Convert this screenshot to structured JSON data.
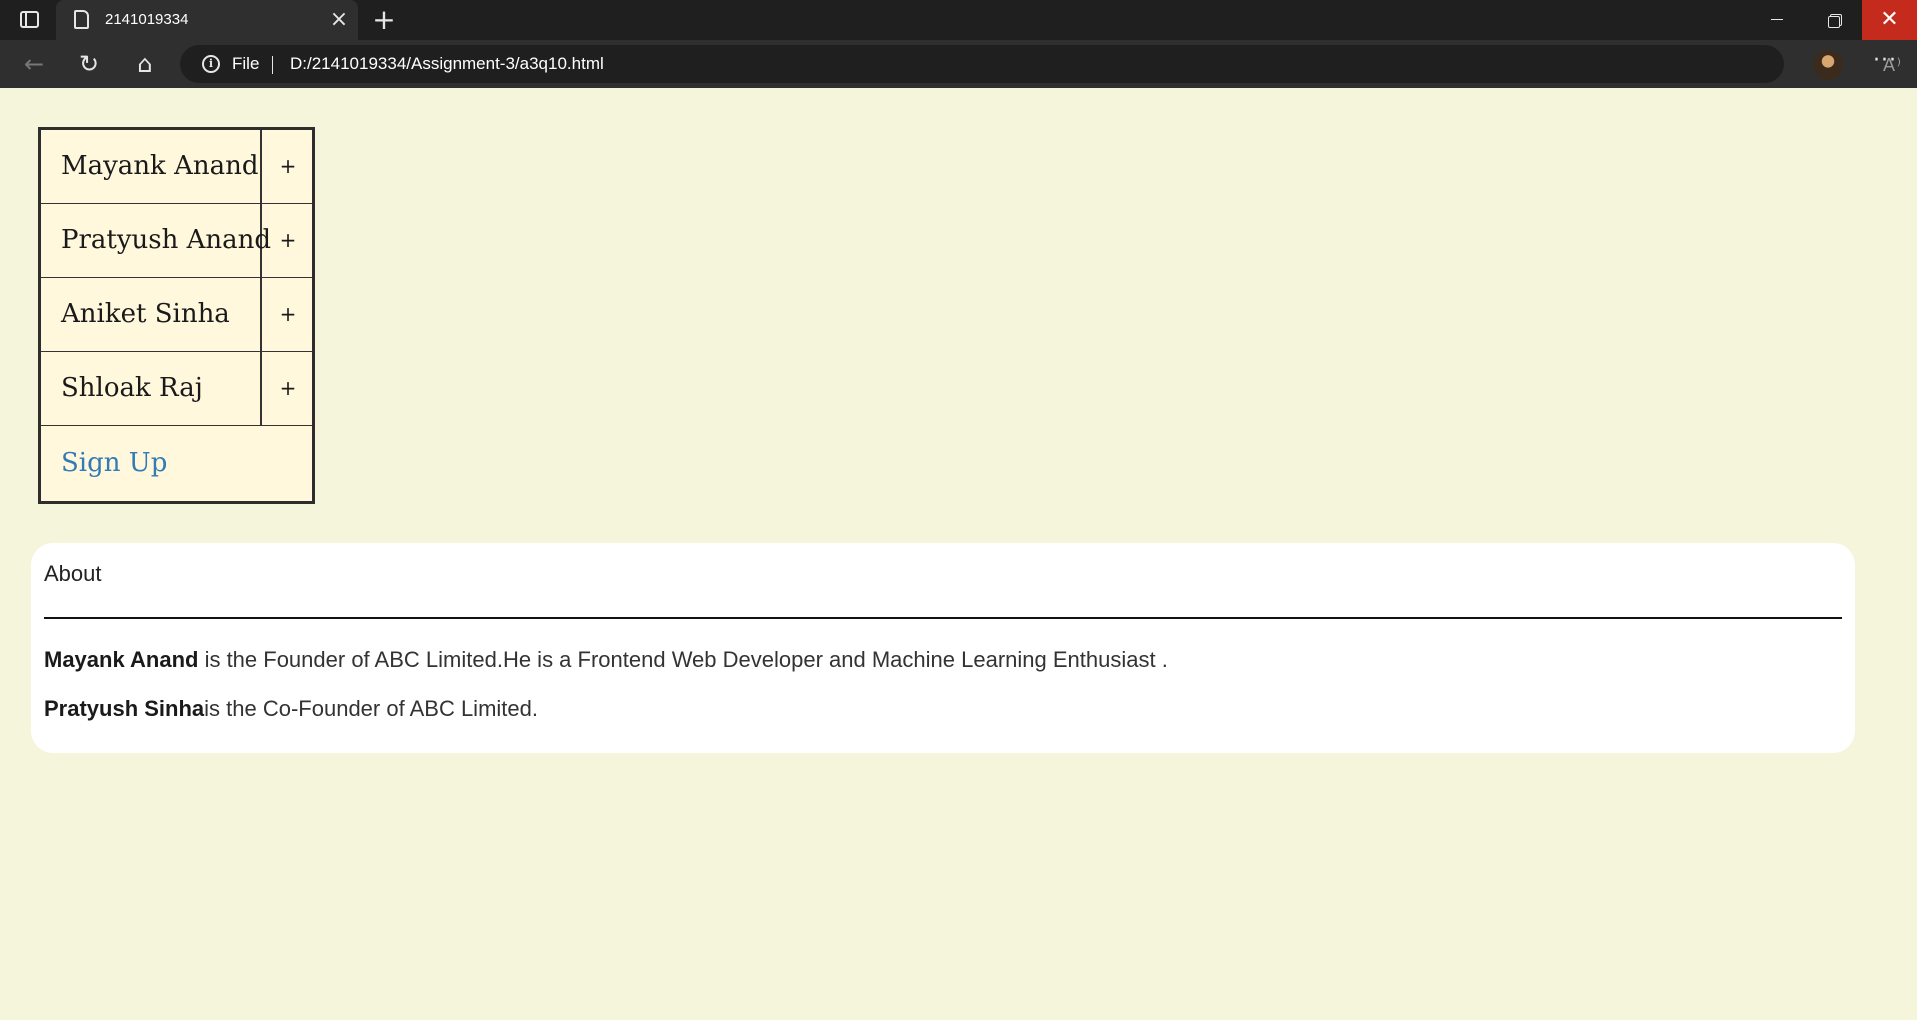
{
  "browser": {
    "tab_title": "2141019334",
    "tab_close": "×",
    "new_tab": "+",
    "scheme_label": "File",
    "url": "D:/2141019334/Assignment-3/a3q10.html",
    "read_aloud": "A ⁾",
    "more": "···",
    "window_close": "✕"
  },
  "menu": {
    "items": [
      {
        "label": "Mayank Anand",
        "toggle": "+"
      },
      {
        "label": "Pratyush Anand",
        "toggle": "+"
      },
      {
        "label": "Aniket Sinha",
        "toggle": "+"
      },
      {
        "label": "Shloak Raj",
        "toggle": "+"
      }
    ],
    "signup_label": "Sign Up",
    "signup_color": "#337ab7"
  },
  "about": {
    "title": "About",
    "paragraphs": [
      {
        "name": "Mayank Anand",
        "text": " is the Founder of ABC Limited.He is a Frontend Web Developer and Machine Learning Enthusiast ."
      },
      {
        "name": "Pratyush Sinha",
        "text": "is the Co-Founder of ABC Limited."
      }
    ]
  },
  "colors": {
    "page_background": "#f5f5dc",
    "menu_background": "#fff8dc",
    "card_background": "#ffffff",
    "chrome_dark": "#1f1f1f",
    "chrome_toolbar": "#2f2f2f",
    "close_red": "#c42b1c"
  }
}
